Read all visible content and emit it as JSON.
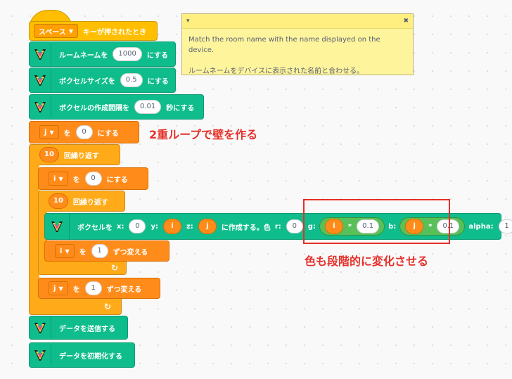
{
  "hat_block": {
    "dropdown": "スペース",
    "text": "キーが押されたとき"
  },
  "comment": {
    "line1": "Match the room name with the name displayed on the device.",
    "line2": "ルームネームをデバイスに表示された名前と合わせる。"
  },
  "blocks": {
    "room_name": {
      "label": "ルームネームを",
      "value": "1000",
      "suffix": "にする"
    },
    "voxel_size": {
      "label": "ボクセルサイズを",
      "value": "0.5",
      "suffix": "にする"
    },
    "interval": {
      "label": "ボクセルの作成間隔を",
      "value": "0.01",
      "suffix": "秒にする"
    },
    "set_j": {
      "var": "j",
      "mid": "を",
      "value": "0",
      "suffix": "にする"
    },
    "repeat_outer": {
      "count": "10",
      "label": "回繰り返す"
    },
    "set_i": {
      "var": "i",
      "mid": "を",
      "value": "0",
      "suffix": "にする"
    },
    "repeat_inner": {
      "count": "10",
      "label": "回繰り返す"
    },
    "create_voxel": {
      "label": "ボクセルを",
      "x_label": "x:",
      "x": "0",
      "y_label": "y:",
      "y": "i",
      "z_label": "z:",
      "z": "j",
      "mid": "に作成する。色",
      "r_label": "r:",
      "r": "0",
      "g_label": "g:",
      "g_var": "i",
      "g_op": "*",
      "g_num": "0.1",
      "b_label": "b:",
      "b_var": "j",
      "b_op": "*",
      "b_num": "0.1",
      "alpha_label": "alpha:",
      "alpha": "1"
    },
    "change_i": {
      "var": "i",
      "mid": "を",
      "value": "1",
      "suffix": "ずつ変える"
    },
    "change_j": {
      "var": "j",
      "mid": "を",
      "value": "1",
      "suffix": "ずつ変える"
    },
    "send_data": {
      "label": "データを送信する"
    },
    "init_data": {
      "label": "データを初期化する"
    }
  },
  "annotations": {
    "loop_note": "2重ループで壁を作る",
    "color_note": "色も段階的に変化させる"
  },
  "colors": {
    "event": "#ffbf00",
    "extension": "#0fbd8c",
    "control": "#ffab19",
    "variable": "#ff8c1a",
    "operator": "#59c059",
    "annotation": "#e5302a",
    "comment": "#fef49c"
  }
}
